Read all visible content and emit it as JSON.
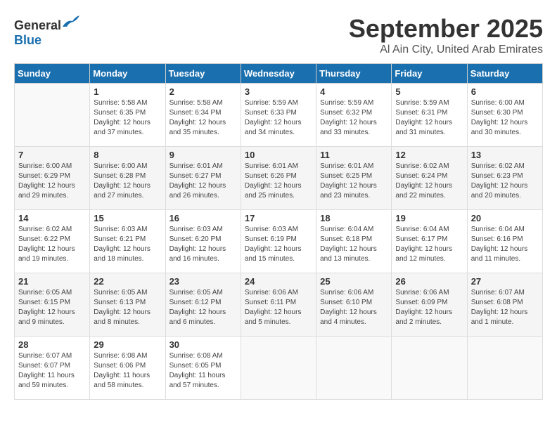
{
  "logo": {
    "text_general": "General",
    "text_blue": "Blue"
  },
  "title": "September 2025",
  "location": "Al Ain City, United Arab Emirates",
  "days_of_week": [
    "Sunday",
    "Monday",
    "Tuesday",
    "Wednesday",
    "Thursday",
    "Friday",
    "Saturday"
  ],
  "weeks": [
    [
      {
        "day": "",
        "sunrise": "",
        "sunset": "",
        "daylight": ""
      },
      {
        "day": "1",
        "sunrise": "Sunrise: 5:58 AM",
        "sunset": "Sunset: 6:35 PM",
        "daylight": "Daylight: 12 hours and 37 minutes."
      },
      {
        "day": "2",
        "sunrise": "Sunrise: 5:58 AM",
        "sunset": "Sunset: 6:34 PM",
        "daylight": "Daylight: 12 hours and 35 minutes."
      },
      {
        "day": "3",
        "sunrise": "Sunrise: 5:59 AM",
        "sunset": "Sunset: 6:33 PM",
        "daylight": "Daylight: 12 hours and 34 minutes."
      },
      {
        "day": "4",
        "sunrise": "Sunrise: 5:59 AM",
        "sunset": "Sunset: 6:32 PM",
        "daylight": "Daylight: 12 hours and 33 minutes."
      },
      {
        "day": "5",
        "sunrise": "Sunrise: 5:59 AM",
        "sunset": "Sunset: 6:31 PM",
        "daylight": "Daylight: 12 hours and 31 minutes."
      },
      {
        "day": "6",
        "sunrise": "Sunrise: 6:00 AM",
        "sunset": "Sunset: 6:30 PM",
        "daylight": "Daylight: 12 hours and 30 minutes."
      }
    ],
    [
      {
        "day": "7",
        "sunrise": "Sunrise: 6:00 AM",
        "sunset": "Sunset: 6:29 PM",
        "daylight": "Daylight: 12 hours and 29 minutes."
      },
      {
        "day": "8",
        "sunrise": "Sunrise: 6:00 AM",
        "sunset": "Sunset: 6:28 PM",
        "daylight": "Daylight: 12 hours and 27 minutes."
      },
      {
        "day": "9",
        "sunrise": "Sunrise: 6:01 AM",
        "sunset": "Sunset: 6:27 PM",
        "daylight": "Daylight: 12 hours and 26 minutes."
      },
      {
        "day": "10",
        "sunrise": "Sunrise: 6:01 AM",
        "sunset": "Sunset: 6:26 PM",
        "daylight": "Daylight: 12 hours and 25 minutes."
      },
      {
        "day": "11",
        "sunrise": "Sunrise: 6:01 AM",
        "sunset": "Sunset: 6:25 PM",
        "daylight": "Daylight: 12 hours and 23 minutes."
      },
      {
        "day": "12",
        "sunrise": "Sunrise: 6:02 AM",
        "sunset": "Sunset: 6:24 PM",
        "daylight": "Daylight: 12 hours and 22 minutes."
      },
      {
        "day": "13",
        "sunrise": "Sunrise: 6:02 AM",
        "sunset": "Sunset: 6:23 PM",
        "daylight": "Daylight: 12 hours and 20 minutes."
      }
    ],
    [
      {
        "day": "14",
        "sunrise": "Sunrise: 6:02 AM",
        "sunset": "Sunset: 6:22 PM",
        "daylight": "Daylight: 12 hours and 19 minutes."
      },
      {
        "day": "15",
        "sunrise": "Sunrise: 6:03 AM",
        "sunset": "Sunset: 6:21 PM",
        "daylight": "Daylight: 12 hours and 18 minutes."
      },
      {
        "day": "16",
        "sunrise": "Sunrise: 6:03 AM",
        "sunset": "Sunset: 6:20 PM",
        "daylight": "Daylight: 12 hours and 16 minutes."
      },
      {
        "day": "17",
        "sunrise": "Sunrise: 6:03 AM",
        "sunset": "Sunset: 6:19 PM",
        "daylight": "Daylight: 12 hours and 15 minutes."
      },
      {
        "day": "18",
        "sunrise": "Sunrise: 6:04 AM",
        "sunset": "Sunset: 6:18 PM",
        "daylight": "Daylight: 12 hours and 13 minutes."
      },
      {
        "day": "19",
        "sunrise": "Sunrise: 6:04 AM",
        "sunset": "Sunset: 6:17 PM",
        "daylight": "Daylight: 12 hours and 12 minutes."
      },
      {
        "day": "20",
        "sunrise": "Sunrise: 6:04 AM",
        "sunset": "Sunset: 6:16 PM",
        "daylight": "Daylight: 12 hours and 11 minutes."
      }
    ],
    [
      {
        "day": "21",
        "sunrise": "Sunrise: 6:05 AM",
        "sunset": "Sunset: 6:15 PM",
        "daylight": "Daylight: 12 hours and 9 minutes."
      },
      {
        "day": "22",
        "sunrise": "Sunrise: 6:05 AM",
        "sunset": "Sunset: 6:13 PM",
        "daylight": "Daylight: 12 hours and 8 minutes."
      },
      {
        "day": "23",
        "sunrise": "Sunrise: 6:05 AM",
        "sunset": "Sunset: 6:12 PM",
        "daylight": "Daylight: 12 hours and 6 minutes."
      },
      {
        "day": "24",
        "sunrise": "Sunrise: 6:06 AM",
        "sunset": "Sunset: 6:11 PM",
        "daylight": "Daylight: 12 hours and 5 minutes."
      },
      {
        "day": "25",
        "sunrise": "Sunrise: 6:06 AM",
        "sunset": "Sunset: 6:10 PM",
        "daylight": "Daylight: 12 hours and 4 minutes."
      },
      {
        "day": "26",
        "sunrise": "Sunrise: 6:06 AM",
        "sunset": "Sunset: 6:09 PM",
        "daylight": "Daylight: 12 hours and 2 minutes."
      },
      {
        "day": "27",
        "sunrise": "Sunrise: 6:07 AM",
        "sunset": "Sunset: 6:08 PM",
        "daylight": "Daylight: 12 hours and 1 minute."
      }
    ],
    [
      {
        "day": "28",
        "sunrise": "Sunrise: 6:07 AM",
        "sunset": "Sunset: 6:07 PM",
        "daylight": "Daylight: 11 hours and 59 minutes."
      },
      {
        "day": "29",
        "sunrise": "Sunrise: 6:08 AM",
        "sunset": "Sunset: 6:06 PM",
        "daylight": "Daylight: 11 hours and 58 minutes."
      },
      {
        "day": "30",
        "sunrise": "Sunrise: 6:08 AM",
        "sunset": "Sunset: 6:05 PM",
        "daylight": "Daylight: 11 hours and 57 minutes."
      },
      {
        "day": "",
        "sunrise": "",
        "sunset": "",
        "daylight": ""
      },
      {
        "day": "",
        "sunrise": "",
        "sunset": "",
        "daylight": ""
      },
      {
        "day": "",
        "sunrise": "",
        "sunset": "",
        "daylight": ""
      },
      {
        "day": "",
        "sunrise": "",
        "sunset": "",
        "daylight": ""
      }
    ]
  ]
}
